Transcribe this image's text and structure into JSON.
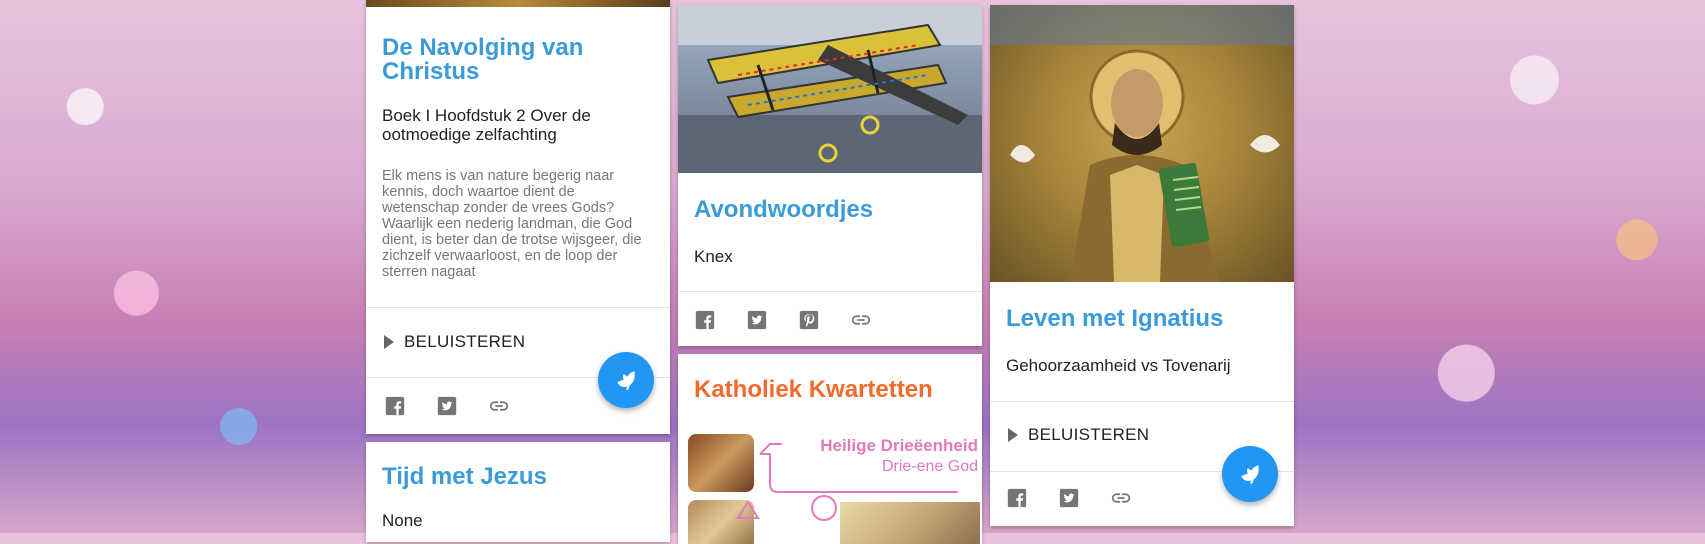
{
  "cards": {
    "navolging": {
      "title": "De Navolging van Christus",
      "subtitle": "Boek I Hoofdstuk 2 Over de ootmoedige zelfachting",
      "body": "Elk mens is van nature begerig naar kennis, doch waartoe dient de wetenschap zonder de vrees Gods? Waarlijk een nederig landman, die God dient, is beter dan de trotse wijsgeer, die zichzelf verwaarloost, en de loop der sterren nagaat",
      "listen_label": "BELUISTEREN"
    },
    "jezus": {
      "title": "Tijd met Jezus",
      "subtitle": "None"
    },
    "avondwoordjes": {
      "title": "Avondwoordjes",
      "subtitle": "Knex"
    },
    "kwartetten": {
      "title": "Katholiek Kwartetten",
      "banner_title": "Heilige Drieëenheid",
      "banner_sub": "Drie-ene God"
    },
    "ignatius": {
      "title": "Leven met Ignatius",
      "subtitle": "Gehoorzaamheid vs Tovenarij",
      "listen_label": "BELUISTEREN"
    }
  },
  "icons": [
    "facebook-icon",
    "twitter-icon",
    "pinterest-icon",
    "link-icon",
    "play-icon",
    "dove-icon"
  ],
  "colors": {
    "title_blue": "#3b9bd9",
    "title_orange": "#f06b2c",
    "fab_blue": "#2196f3",
    "banner_pink": "#e07ab8"
  }
}
